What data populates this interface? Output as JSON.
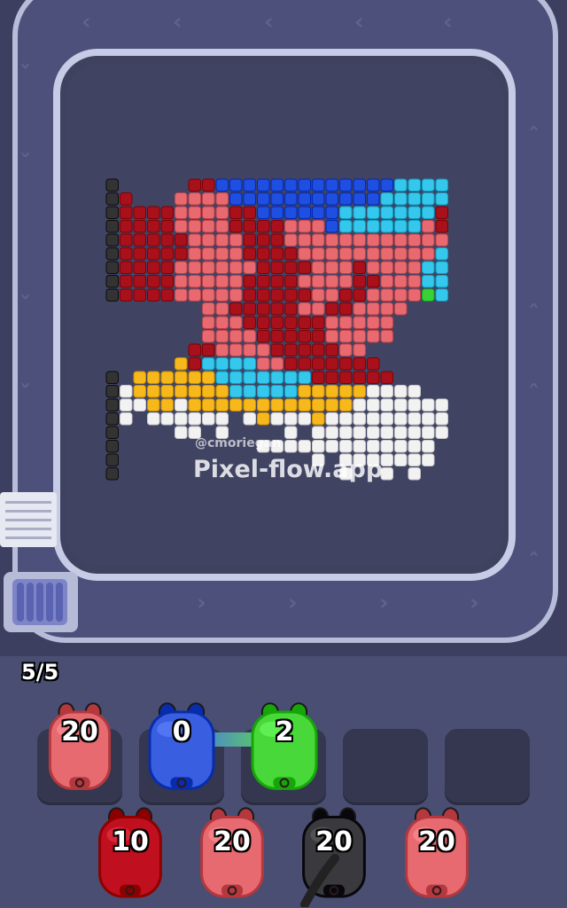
{
  "watermark": {
    "handle": "@cmoriegan",
    "site": "Pixel-flow.app"
  },
  "capacity": "5/5",
  "icons": {
    "track_arrow": "chevron-icon",
    "pig": "pig-shooter-icon"
  },
  "colors": {
    "background": "#4a4e72",
    "track": "#4c507a",
    "board": "#404362",
    "dark_red": "#a8101c",
    "salmon": "#e86a70",
    "blue": "#1f4fe0",
    "cyan": "#35c8ec",
    "green": "#3ad03a",
    "yellow": "#f6b81a",
    "white": "#f2f2f2",
    "black": "#333333"
  },
  "active_shooters": [
    {
      "color": "salmon",
      "count": "20",
      "hex": "#e66a70"
    },
    {
      "color": "blue",
      "count": "0",
      "hex": "#3a5ee0"
    },
    {
      "color": "green",
      "count": "2",
      "hex": "#48d83a"
    },
    {
      "color": "empty",
      "count": ""
    },
    {
      "color": "empty",
      "count": ""
    }
  ],
  "queue_shooters": [
    {
      "color": "dark-red",
      "count": "10",
      "hex": "#c01020"
    },
    {
      "color": "salmon",
      "count": "20",
      "hex": "#e66a70"
    },
    {
      "color": "black",
      "count": "20",
      "hex": "#3a3a3e"
    },
    {
      "color": "salmon",
      "count": "20",
      "hex": "#e66a70"
    }
  ]
}
